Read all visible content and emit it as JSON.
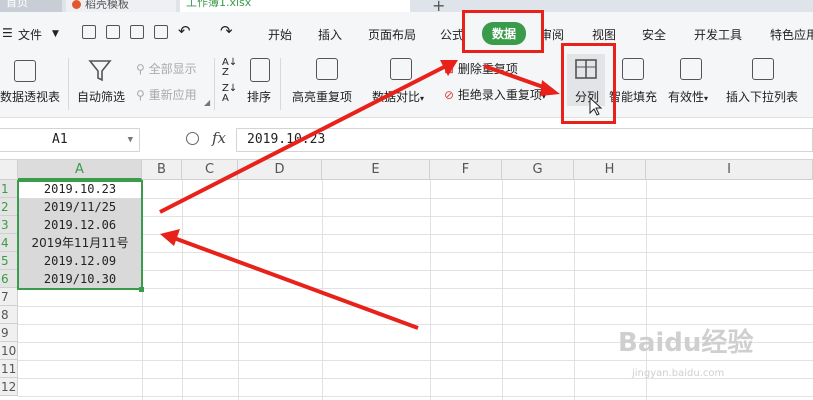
{
  "tabs": [
    {
      "label": "首页"
    },
    {
      "label": "稻壳模板"
    },
    {
      "label": "工作簿1.xlsx"
    }
  ],
  "menu": {
    "file_label": "文件",
    "items": [
      "开始",
      "插入",
      "页面布局",
      "公式",
      "数据",
      "审阅",
      "视图",
      "安全",
      "开发工具",
      "特色应用"
    ],
    "active": "数据"
  },
  "ribbon": {
    "pivot_table": "数据透视表",
    "auto_filter": "自动筛选",
    "show_all": "全部显示",
    "reapply": "重新应用",
    "sort": "排序",
    "highlight_duplicates": "高亮重复项",
    "data_compare": "数据对比",
    "remove_duplicates": "删除重复项",
    "reject_duplicates": "拒绝录入重复项",
    "split_column": "分列",
    "smart_fill": "智能填充",
    "validity": "有效性",
    "insert_dropdown": "插入下拉列表"
  },
  "formula_bar": {
    "name_box": "A1",
    "fx_label": "fx",
    "content": "2019.10.23"
  },
  "grid": {
    "columns": [
      "A",
      "B",
      "C",
      "D",
      "E",
      "F",
      "G",
      "H",
      "I"
    ],
    "selected_column": "A",
    "row_numbers": [
      "1",
      "2",
      "3",
      "4",
      "5",
      "6",
      "7",
      "8",
      "9",
      "10",
      "11",
      "12"
    ],
    "cells": [
      "2019.10.23",
      "2019/11/25",
      "2019.12.06",
      "2019年11月11号",
      "2019.12.09",
      "2019/10.30"
    ]
  },
  "watermark": {
    "brand": "Baidu经验",
    "url": "jingyan.baidu.com"
  },
  "colors": {
    "accent_green": "#3a9b4a",
    "annotation_red": "#e8211a"
  }
}
